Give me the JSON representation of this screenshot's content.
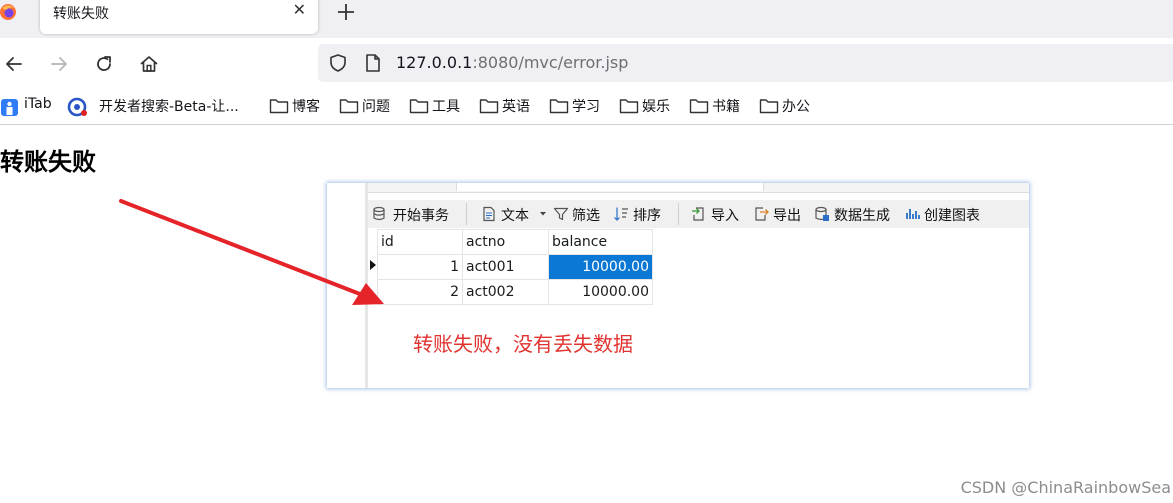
{
  "browser": {
    "tab": {
      "title": "转账失败",
      "close_glyph": "✕"
    },
    "new_tab_icon": "plus-icon",
    "nav_icons": [
      "back-arrow-icon",
      "forward-arrow-icon",
      "reload-icon",
      "home-icon"
    ],
    "address": {
      "host": "127.0.0.1",
      "rest": ":8080/mvc/error.jsp"
    },
    "bookmarks": [
      {
        "label": "iTab",
        "icon": "itab-icon"
      },
      {
        "label": "开发者搜索-Beta-让...",
        "icon": "devsearch-icon"
      },
      {
        "label": "博客",
        "icon": "folder-icon"
      },
      {
        "label": "问题",
        "icon": "folder-icon"
      },
      {
        "label": "工具",
        "icon": "folder-icon"
      },
      {
        "label": "英语",
        "icon": "folder-icon"
      },
      {
        "label": "学习",
        "icon": "folder-icon"
      },
      {
        "label": "娱乐",
        "icon": "folder-icon"
      },
      {
        "label": "书籍",
        "icon": "folder-icon"
      },
      {
        "label": "办公",
        "icon": "folder-icon"
      }
    ]
  },
  "page": {
    "heading": "转账失败"
  },
  "embedded_screenshot": {
    "toolbar": {
      "begin_transaction": "开始事务",
      "text": "文本",
      "filter": "筛选",
      "sort": "排序",
      "import": "导入",
      "export": "导出",
      "data_generation": "数据生成",
      "create_chart": "创建图表"
    },
    "table": {
      "columns": [
        "id",
        "actno",
        "balance"
      ],
      "rows": [
        {
          "id": "1",
          "actno": "act001",
          "balance": "10000.00"
        },
        {
          "id": "2",
          "actno": "act002",
          "balance": "10000.00"
        }
      ]
    },
    "caption": "转账失败，没有丢失数据",
    "arrow_color": "#e5242a"
  },
  "watermark": "CSDN @ChinaRainbowSea"
}
